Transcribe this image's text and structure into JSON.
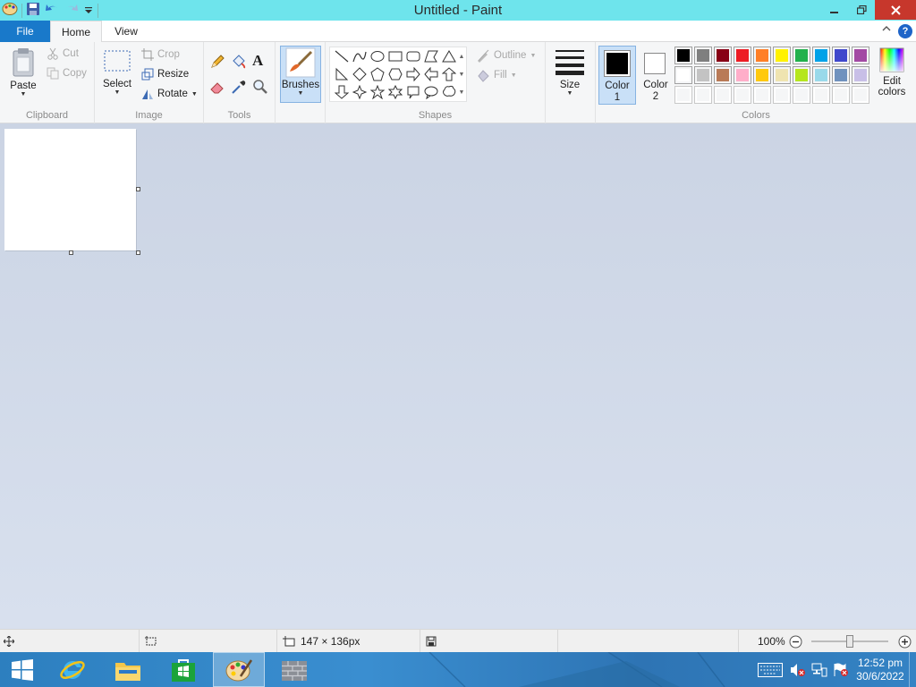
{
  "window": {
    "title": "Untitled - Paint",
    "quick_access": [
      "paint-menu-icon",
      "save-icon",
      "undo-icon",
      "redo-icon",
      "customize-qat-icon"
    ]
  },
  "tabs": {
    "file": "File",
    "home": "Home",
    "view": "View"
  },
  "help": "?",
  "ribbon": {
    "clipboard": {
      "label": "Clipboard",
      "paste": "Paste",
      "cut": "Cut",
      "copy": "Copy"
    },
    "image": {
      "label": "Image",
      "select": "Select",
      "crop": "Crop",
      "resize": "Resize",
      "rotate": "Rotate"
    },
    "tools": {
      "label": "Tools"
    },
    "brushes": {
      "label": "Brushes"
    },
    "shapes": {
      "label": "Shapes",
      "outline": "Outline",
      "fill": "Fill"
    },
    "size": {
      "label": "Size"
    },
    "colors": {
      "label": "Colors",
      "color1": "Color",
      "color1_num": "1",
      "color2": "Color",
      "color2_num": "2",
      "color1_value": "#000000",
      "color2_value": "#ffffff",
      "edit_colors": "Edit",
      "edit_colors_2": "colors",
      "palette_row1": [
        "#000000",
        "#7f7f7f",
        "#880015",
        "#ed1c24",
        "#ff7f27",
        "#fff200",
        "#22b14c",
        "#00a2e8",
        "#3f48cc",
        "#a349a4"
      ],
      "palette_row2": [
        "#ffffff",
        "#c3c3c3",
        "#b97a57",
        "#ffaec9",
        "#ffc90e",
        "#efe4b0",
        "#b5e61d",
        "#99d9ea",
        "#7092be",
        "#c8bfe7"
      ],
      "palette_row3": [
        "#f5f6f7",
        "#f5f6f7",
        "#f5f6f7",
        "#f5f6f7",
        "#f5f6f7",
        "#f5f6f7",
        "#f5f6f7",
        "#f5f6f7",
        "#f5f6f7",
        "#f5f6f7"
      ]
    }
  },
  "status": {
    "canvas_size": "147 × 136px",
    "zoom": "100%",
    "zoom_level": 0.5
  },
  "taskbar": {
    "items": [
      "start-icon",
      "internet-explorer-icon",
      "file-explorer-icon",
      "store-icon",
      "paint-app-icon",
      "firewall-app-icon"
    ],
    "time": "12:52 pm",
    "date": "30/6/2022"
  }
}
